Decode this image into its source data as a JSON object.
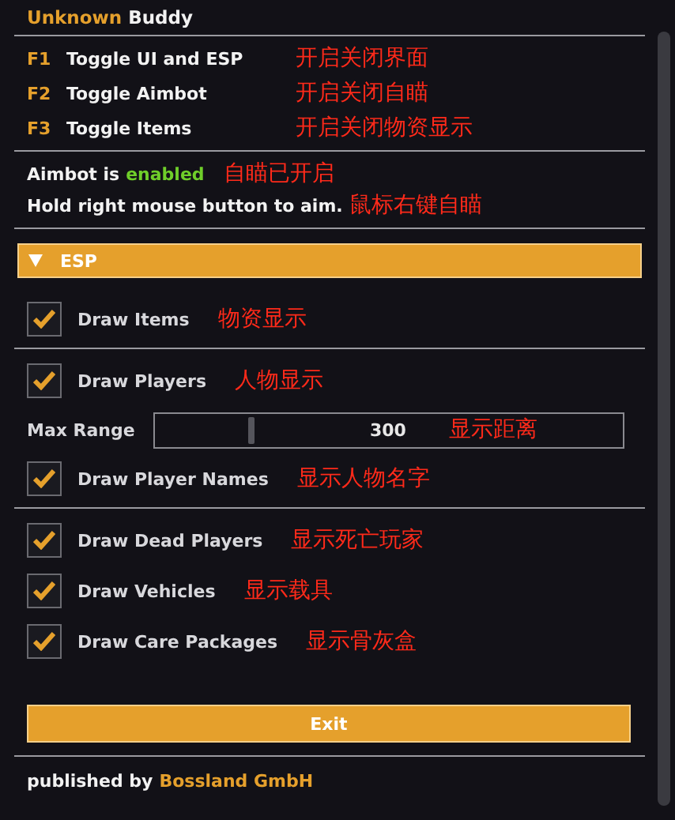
{
  "title": {
    "first": "Unknown",
    "second": "Buddy"
  },
  "hotkeys": [
    {
      "key": "F1",
      "label": "Toggle UI and ESP",
      "note": "开启关闭界面"
    },
    {
      "key": "F2",
      "label": "Toggle Aimbot",
      "note": "开启关闭自瞄"
    },
    {
      "key": "F3",
      "label": "Toggle Items",
      "note": "开启关闭物资显示"
    }
  ],
  "status": {
    "label": "Aimbot is",
    "value": "enabled",
    "enabled": true,
    "note": "自瞄已开启"
  },
  "hint": {
    "text": "Hold right mouse button to aim.",
    "note": "鼠标右键自瞄"
  },
  "section": {
    "title": "ESP",
    "expanded": true,
    "groups": [
      [
        {
          "kind": "checkbox",
          "label": "Draw Items",
          "checked": true,
          "note": "物资显示"
        }
      ],
      [
        {
          "kind": "checkbox",
          "label": "Draw Players",
          "checked": true,
          "note": "人物显示"
        },
        {
          "kind": "slider",
          "label": "Max Range",
          "value": "300",
          "level": 0.2,
          "note": "显示距离"
        },
        {
          "kind": "checkbox",
          "label": "Draw Player Names",
          "checked": true,
          "note": "显示人物名字"
        }
      ],
      [
        {
          "kind": "checkbox",
          "label": "Draw Dead Players",
          "checked": true,
          "note": "显示死亡玩家"
        },
        {
          "kind": "checkbox",
          "label": "Draw Vehicles",
          "checked": true,
          "note": "显示载具"
        },
        {
          "kind": "checkbox",
          "label": "Draw Care Packages",
          "checked": true,
          "note": "显示骨灰盒"
        }
      ]
    ]
  },
  "exit_button": "Exit",
  "footer": {
    "prefix": "published by",
    "publisher": "Bossland GmbH"
  }
}
